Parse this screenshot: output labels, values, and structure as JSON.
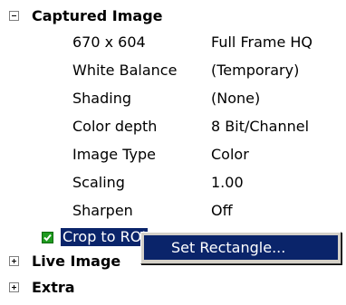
{
  "sections": {
    "captured": {
      "label": "Captured Image",
      "expander": "minus"
    },
    "live": {
      "label": "Live Image",
      "expander": "plus"
    },
    "extra": {
      "label": "Extra",
      "expander": "plus"
    }
  },
  "properties": [
    {
      "name": "670 x 604",
      "value": "Full Frame HQ"
    },
    {
      "name": "White Balance",
      "value": "(Temporary)"
    },
    {
      "name": "Shading",
      "value": "(None)"
    },
    {
      "name": "Color depth",
      "value": "8 Bit/Channel"
    },
    {
      "name": "Image Type",
      "value": "Color"
    },
    {
      "name": "Scaling",
      "value": "1.00"
    },
    {
      "name": "Sharpen",
      "value": "Off"
    }
  ],
  "crop": {
    "label": "Crop to ROI",
    "checked": true
  },
  "context_menu": {
    "items": [
      "Set Rectangle..."
    ]
  },
  "colors": {
    "selection": "#0a246a",
    "checkbox": "#1f9a1f",
    "menu_bg": "#d4d0c8"
  }
}
